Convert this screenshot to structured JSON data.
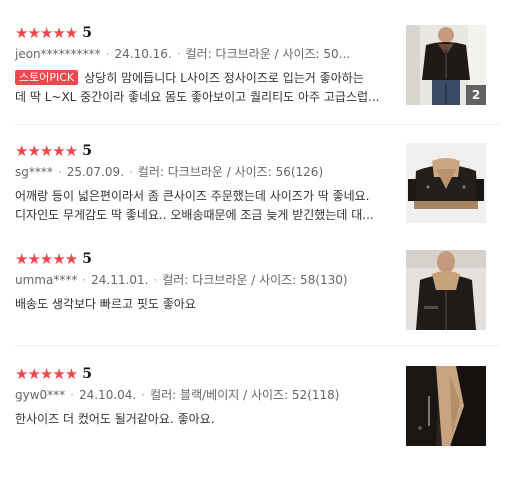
{
  "reviews": [
    {
      "score": "5",
      "user": "jeon**********",
      "date": "24.10.16.",
      "option": "컬러: 다크브라운 / 사이즈: 50...",
      "badge": "스토어PICK",
      "line1": "상당히 맘에듭니다 L사이즈 정사이즈로 입는거 좋아하는",
      "line2": "데 딱 L~XL 중간이라 좋네요 몸도 좋아보이고 퀄리티도 아주 고급스럽...",
      "photo_count": "2",
      "image": "leather-jacket-photo"
    },
    {
      "score": "5",
      "user": "sg****",
      "date": "25.07.09.",
      "option": "컬러: 다크브라운 / 사이즈: 56(126)",
      "line1": "어깨랑 등이 넓은편이라서 좀 큰사이즈 주문했는데 사이즈가 딱 좋네요.",
      "line2": "디자인도 무게감도 딱 좋네요.. 오배송때문에 조금 늦게 받긴했는데 대...",
      "image": "shearling-jacket-photo"
    },
    {
      "score": "5",
      "user": "umma****",
      "date": "24.11.01.",
      "option": "컬러: 다크브라운 / 사이즈: 58(130)",
      "line1": "배송도 생각보다 빠르고 핏도 좋아요",
      "image": "worn-jacket-photo"
    },
    {
      "score": "5",
      "user": "gyw0***",
      "date": "24.10.04.",
      "option": "컬러: 블랙/베이지 / 사이즈: 52(118)",
      "line1": "한사이즈 더 컸어도 될거같아요. 좋아요.",
      "image": "jacket-closeup-photo"
    }
  ]
}
